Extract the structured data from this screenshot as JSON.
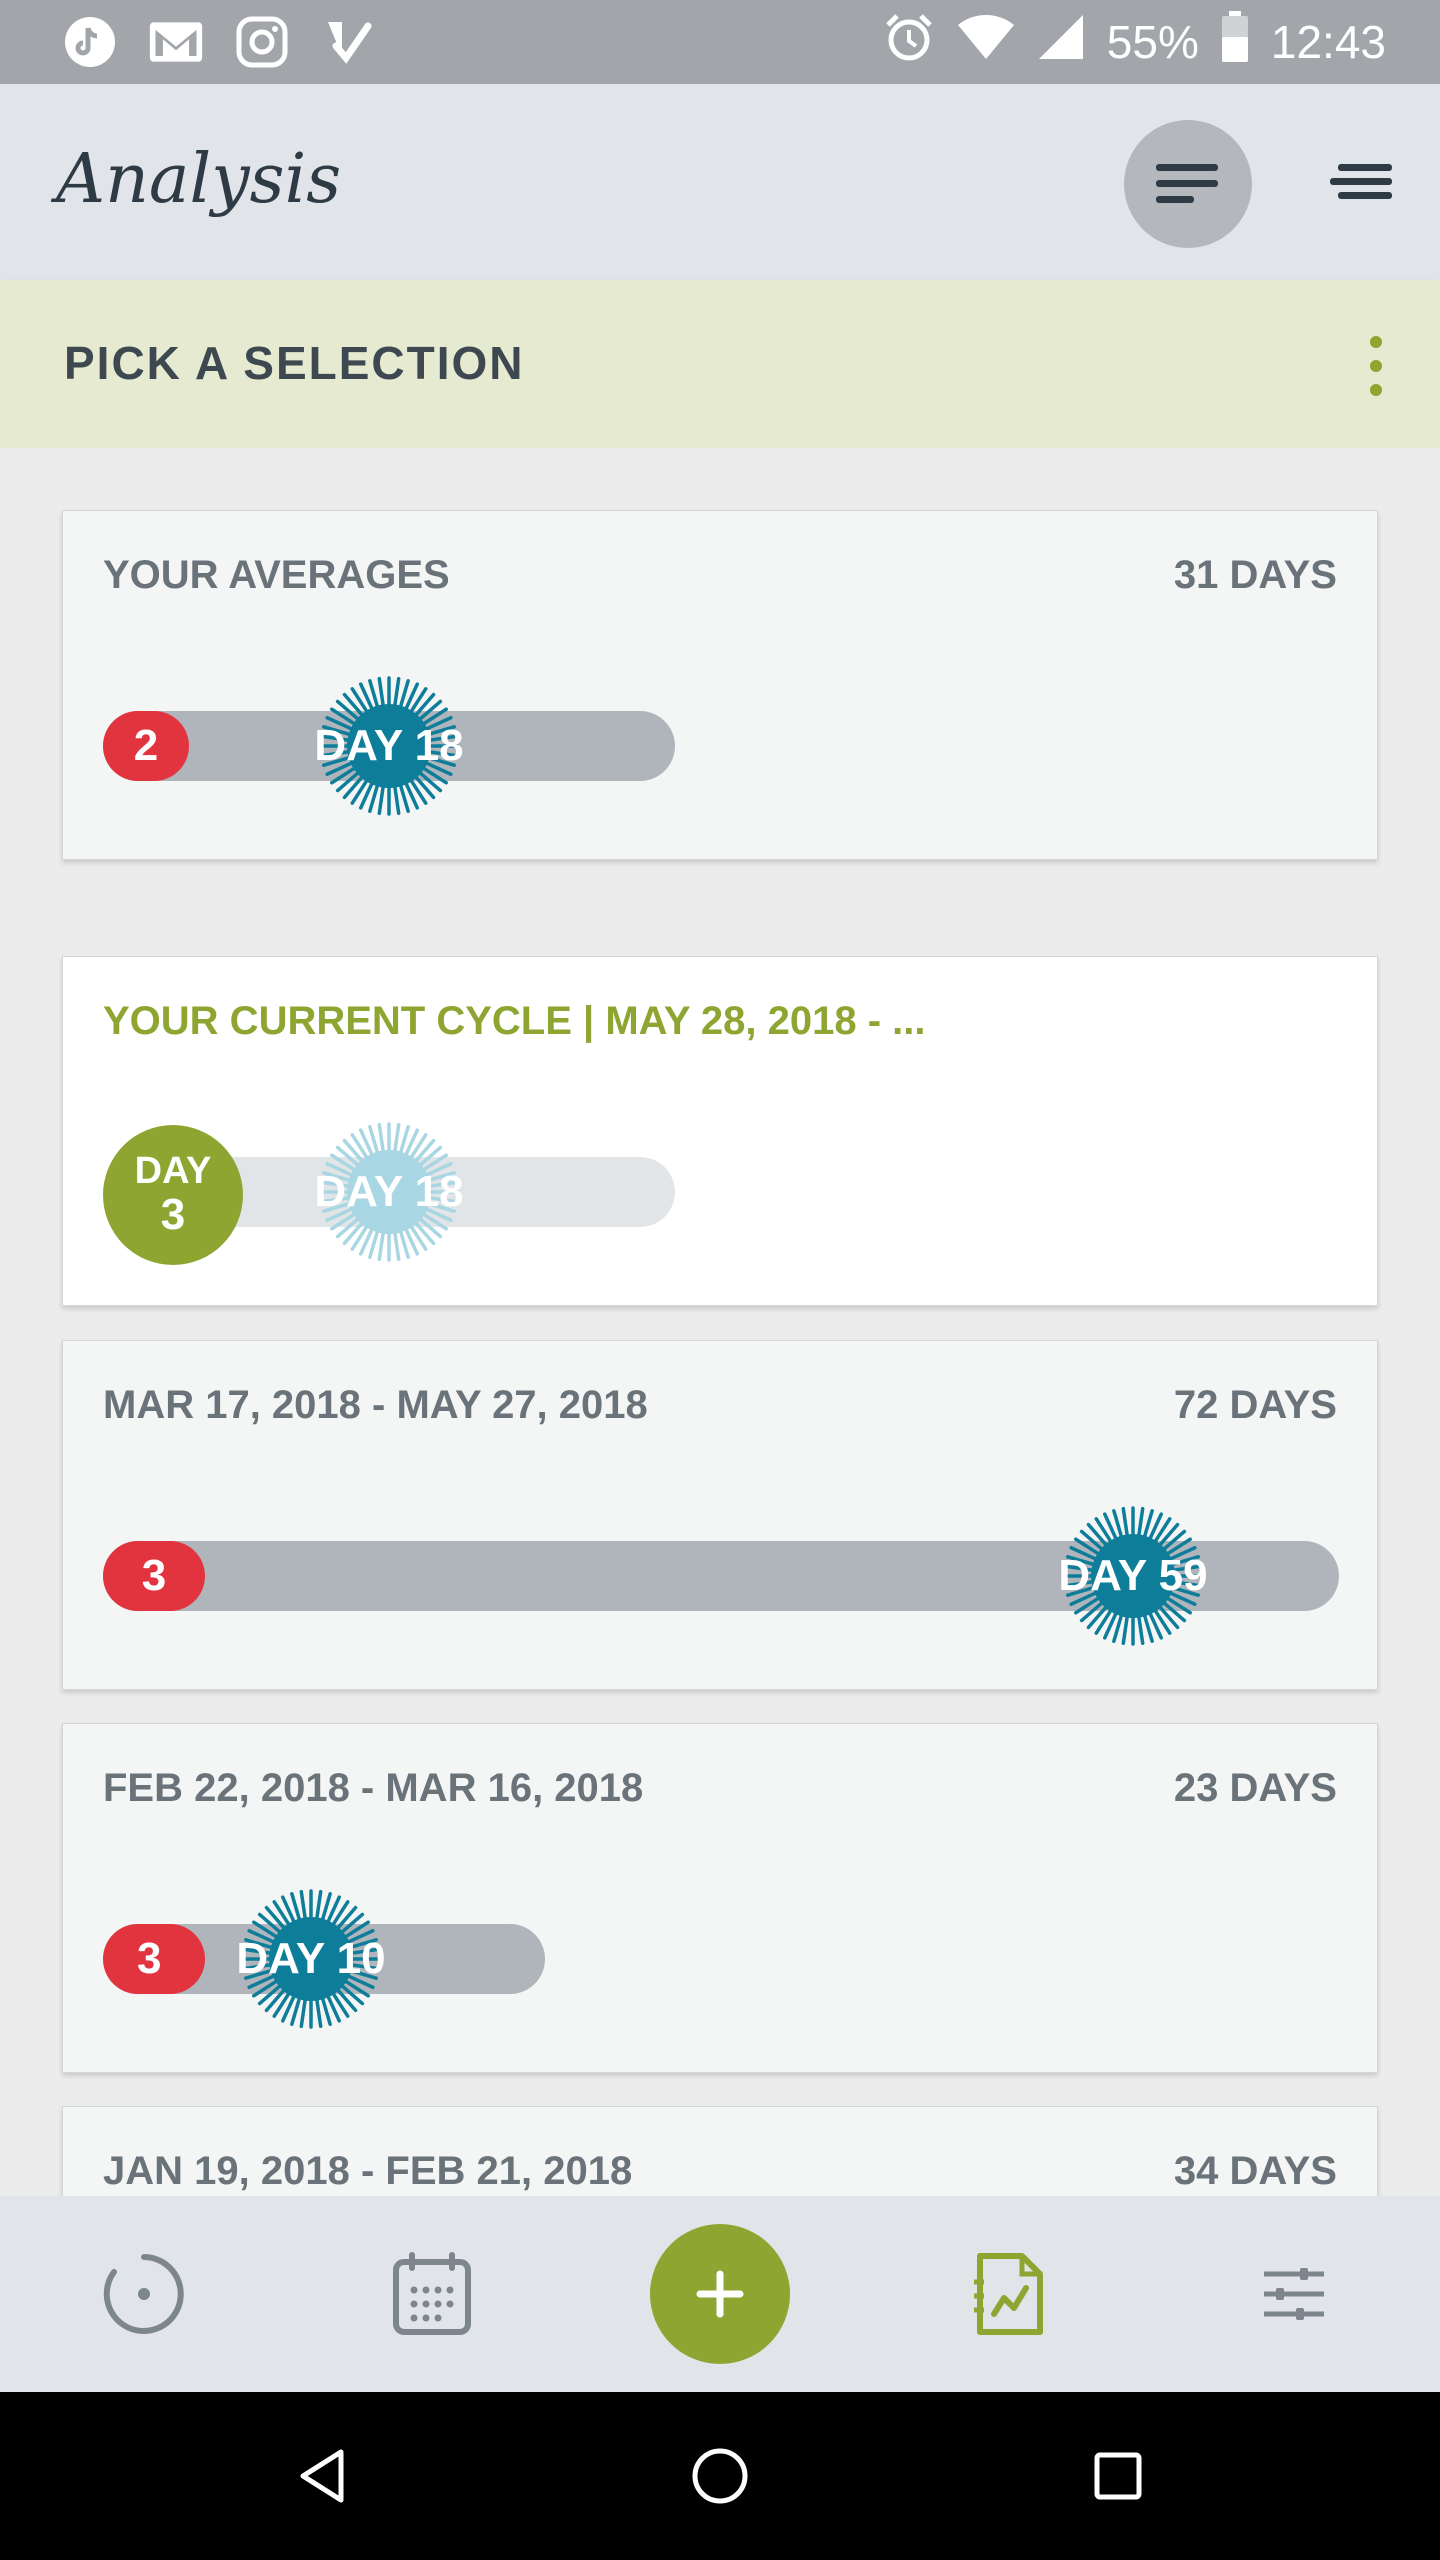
{
  "status_bar": {
    "icons": [
      "tiktok-icon",
      "gmail-icon",
      "instagram-icon",
      "task-check-icon"
    ],
    "battery": "55%",
    "time": "12:43"
  },
  "app_bar": {
    "title": "Analysis"
  },
  "selection": {
    "label": "PICK A SELECTION"
  },
  "cards": [
    {
      "title": "YOUR AVERAGES",
      "days": "31 DAYS",
      "period_days": "2",
      "ovulation_label": "DAY 18",
      "cycle_length": 31,
      "ovulation_day": 18
    },
    {
      "title": "YOUR CURRENT CYCLE | MAY 28, 2018 - ...",
      "current_day_label": "DAY",
      "current_day": "3",
      "ovulation_label": "DAY 18",
      "ovulation_day": 18
    },
    {
      "title": "MAR 17, 2018 - MAY 27, 2018",
      "days": "72 DAYS",
      "period_days": "3",
      "ovulation_label": "DAY 59",
      "cycle_length": 72,
      "ovulation_day": 59
    },
    {
      "title": "FEB 22, 2018 - MAR 16, 2018",
      "days": "23 DAYS",
      "period_days": "3",
      "ovulation_label": "DAY 10",
      "cycle_length": 23,
      "ovulation_day": 10
    },
    {
      "title": "JAN 19, 2018 - FEB 21, 2018",
      "days": "34 DAYS"
    }
  ],
  "colors": {
    "accent_green": "#8fa531",
    "period_red": "#e2343e",
    "ovulation_teal": "#0e7d9a",
    "ovulation_light": "#a8d6e2",
    "track_gray": "#afb5ba"
  },
  "bottom_nav": {
    "items": [
      "cycle-icon",
      "calendar-icon",
      "add-icon",
      "analysis-icon",
      "settings-sliders-icon"
    ],
    "active": "analysis-icon"
  },
  "system_nav": [
    "back-icon",
    "home-icon",
    "recents-icon"
  ]
}
